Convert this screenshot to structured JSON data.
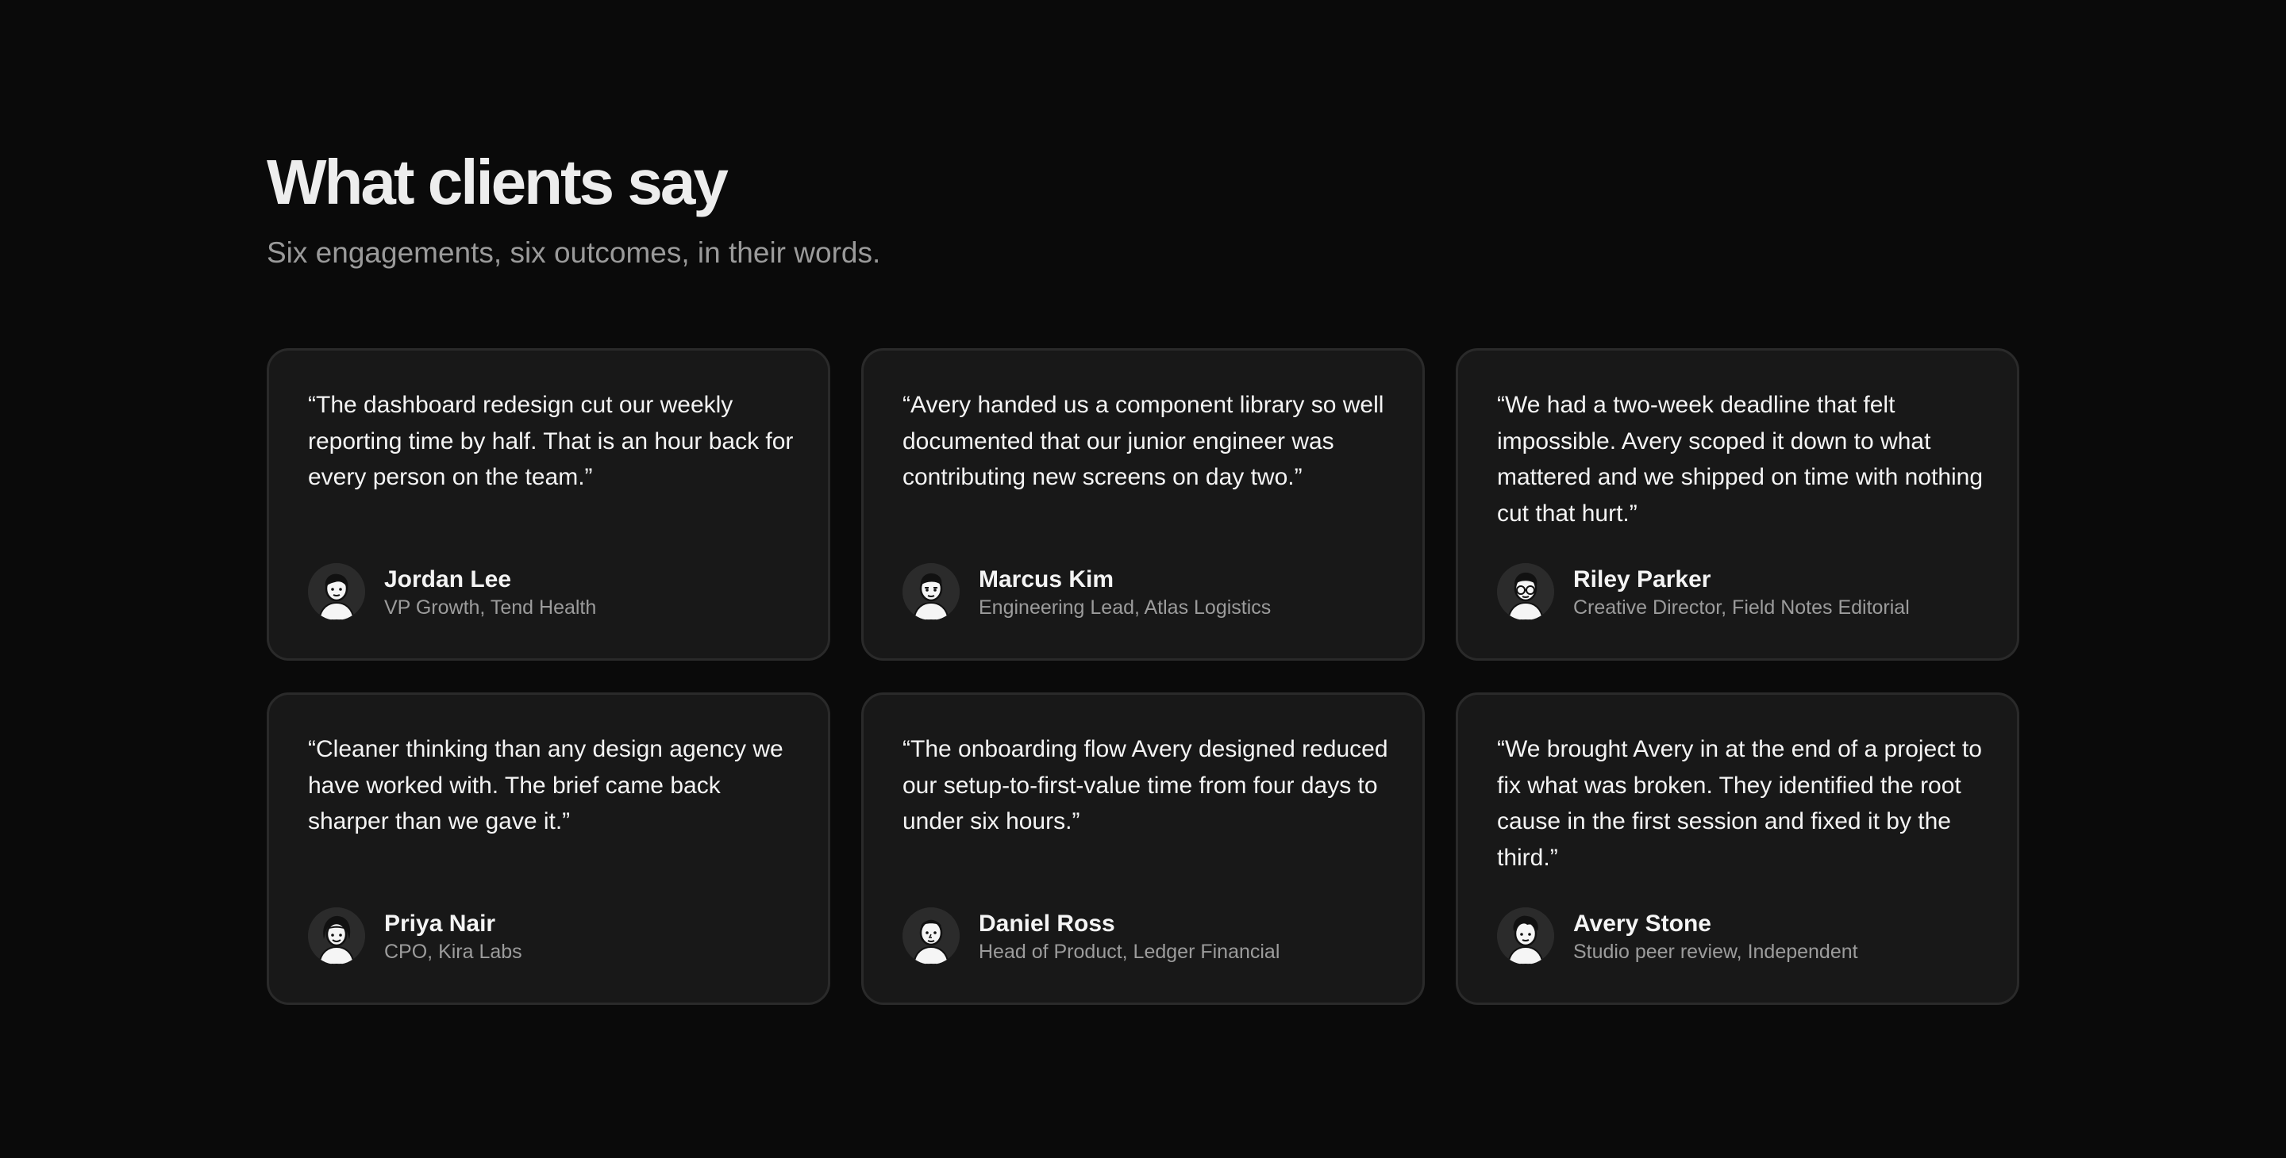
{
  "header": {
    "title": "What clients say",
    "subtitle": "Six engagements, six outcomes, in their words."
  },
  "testimonials": [
    {
      "quote": "“The dashboard redesign cut our weekly reporting time by half. That is an hour back for every person on the team.”",
      "name": "Jordan Lee",
      "role": "VP Growth, Tend Health",
      "avatar_icon": "person-avatar-icon"
    },
    {
      "quote": "“Avery handed us a component library so well documented that our junior engineer was contributing new screens on day two.”",
      "name": "Marcus Kim",
      "role": "Engineering Lead, Atlas Logistics",
      "avatar_icon": "person-avatar-icon"
    },
    {
      "quote": "“We had a two-week deadline that felt impossible. Avery scoped it down to what mattered and we shipped on time with nothing cut that hurt.”",
      "name": "Riley Parker",
      "role": "Creative Director, Field Notes Editorial",
      "avatar_icon": "person-avatar-icon"
    },
    {
      "quote": "“Cleaner thinking than any design agency we have worked with. The brief came back sharper than we gave it.”",
      "name": "Priya Nair",
      "role": "CPO, Kira Labs",
      "avatar_icon": "person-avatar-icon"
    },
    {
      "quote": "“The onboarding flow Avery designed reduced our setup-to-first-value time from four days to under six hours.”",
      "name": "Daniel Ross",
      "role": "Head of Product, Ledger Financial",
      "avatar_icon": "person-avatar-icon"
    },
    {
      "quote": "“We brought Avery in at the end of a project to fix what was broken. They identified the root cause in the first session and fixed it by the third.”",
      "name": "Avery Stone",
      "role": "Studio peer review, Independent",
      "avatar_icon": "person-avatar-icon"
    }
  ],
  "colors": {
    "background": "#0a0a0a",
    "card": "#181818",
    "card_border": "#2a2a2a",
    "text": "#f4f4f4",
    "muted": "#9c9c9c"
  }
}
